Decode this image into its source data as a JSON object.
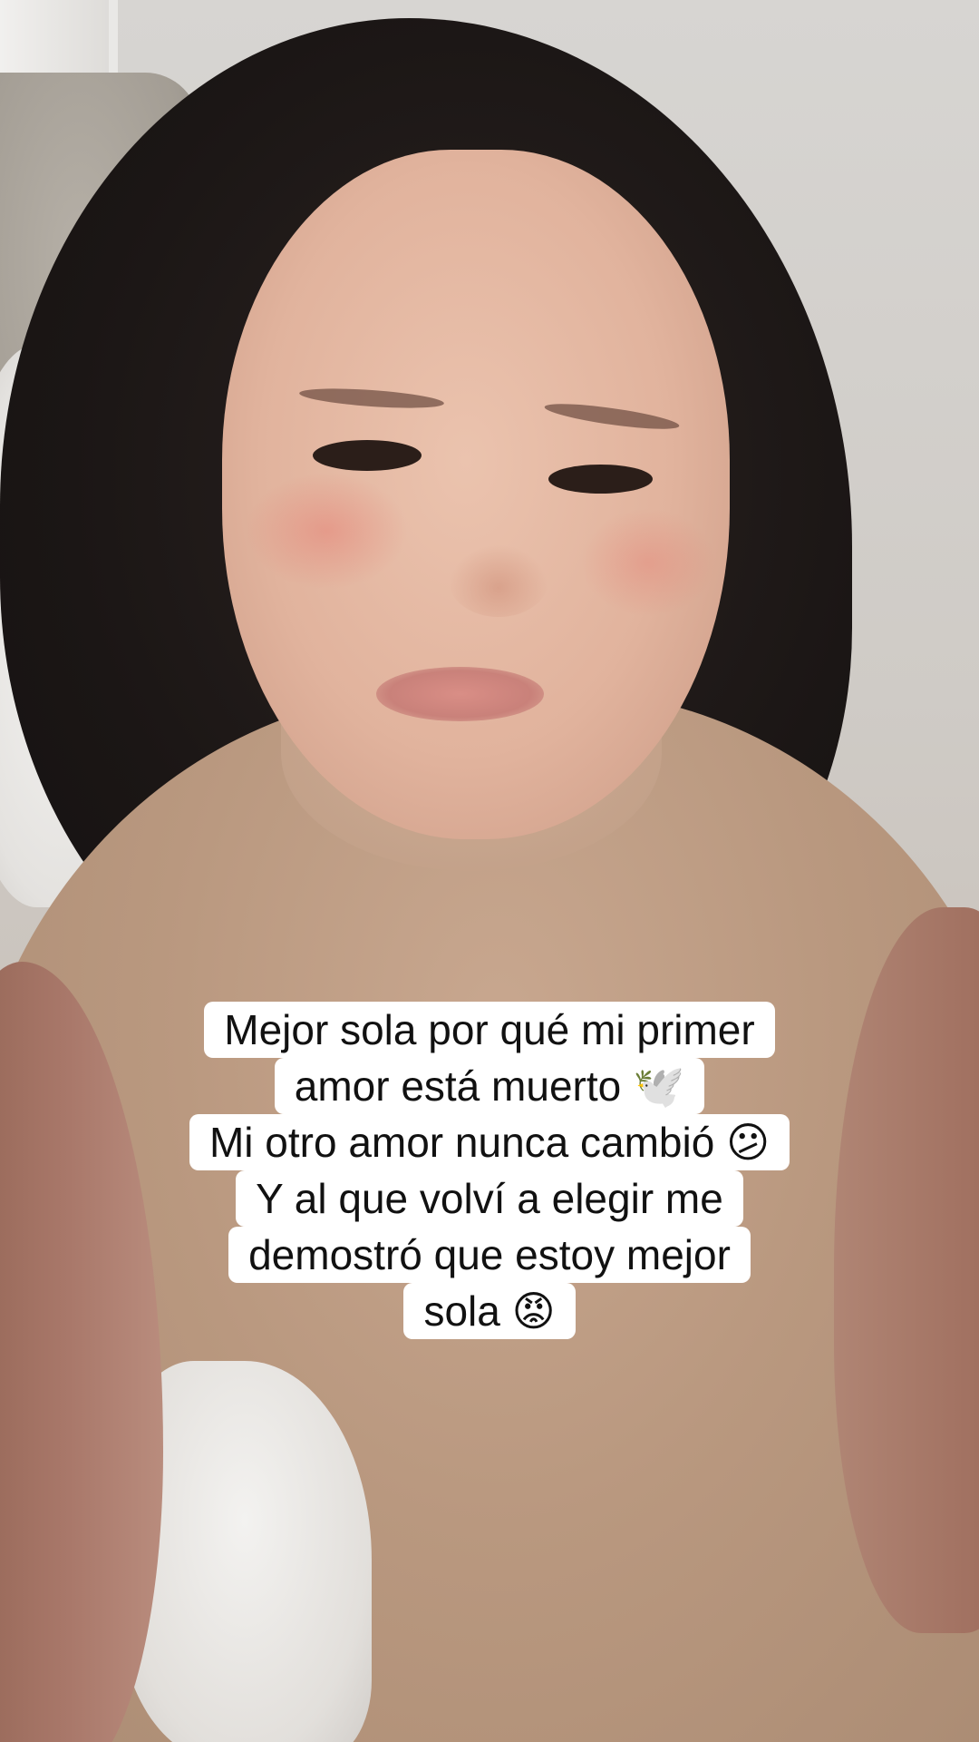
{
  "caption": {
    "lines": [
      "Mejor sola por qué mi primer",
      "amor está muerto 🕊️",
      "Mi otro amor nunca cambió 😕",
      "Y al que volví a elegir me",
      "demostró que estoy mejor",
      "sola 😡"
    ]
  }
}
